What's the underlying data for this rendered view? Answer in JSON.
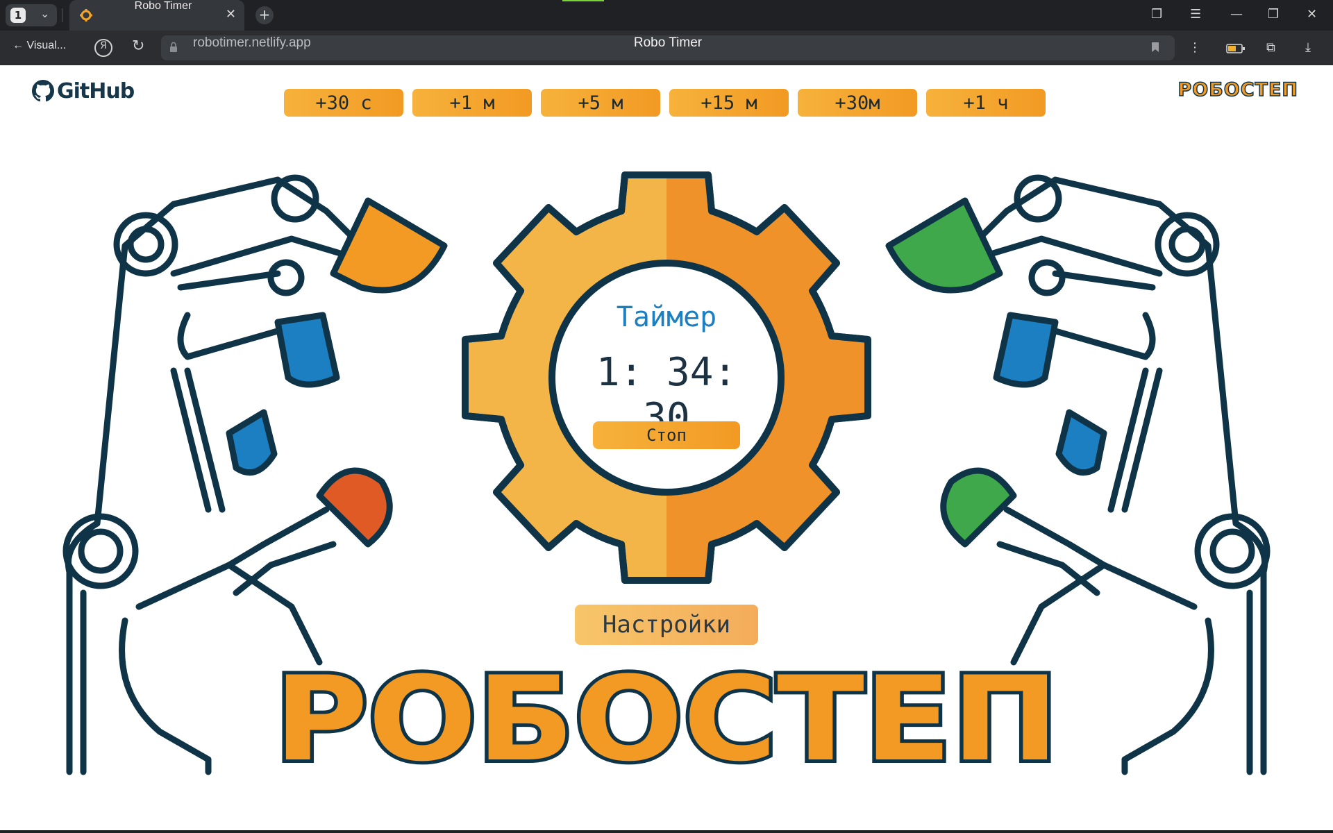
{
  "browser": {
    "tab_count": "1",
    "tab_title": "Robo Timer",
    "back_label": "Visual...",
    "ya_glyph": "Я",
    "url": "robotimer.netlify.app",
    "page_title": "Robo Timer"
  },
  "header": {
    "github_label": "GitHub",
    "brand_label": "РОБОСТЕП"
  },
  "add_buttons": [
    "+30 с",
    "+1 м",
    "+5 м",
    "+15 м",
    "+30м",
    "+1 ч"
  ],
  "timer": {
    "title": "Таймер",
    "value": "1: 34: 30",
    "stop_label": "Стоп"
  },
  "settings_label": "Настройки",
  "logo_word": "РОБОСТЕП",
  "colors": {
    "orange": "#f29a23",
    "light_orange": "#f6b23c",
    "navy": "#0f3448",
    "blue": "#1b7fc2",
    "green": "#3fa84a",
    "red": "#e05a26"
  }
}
